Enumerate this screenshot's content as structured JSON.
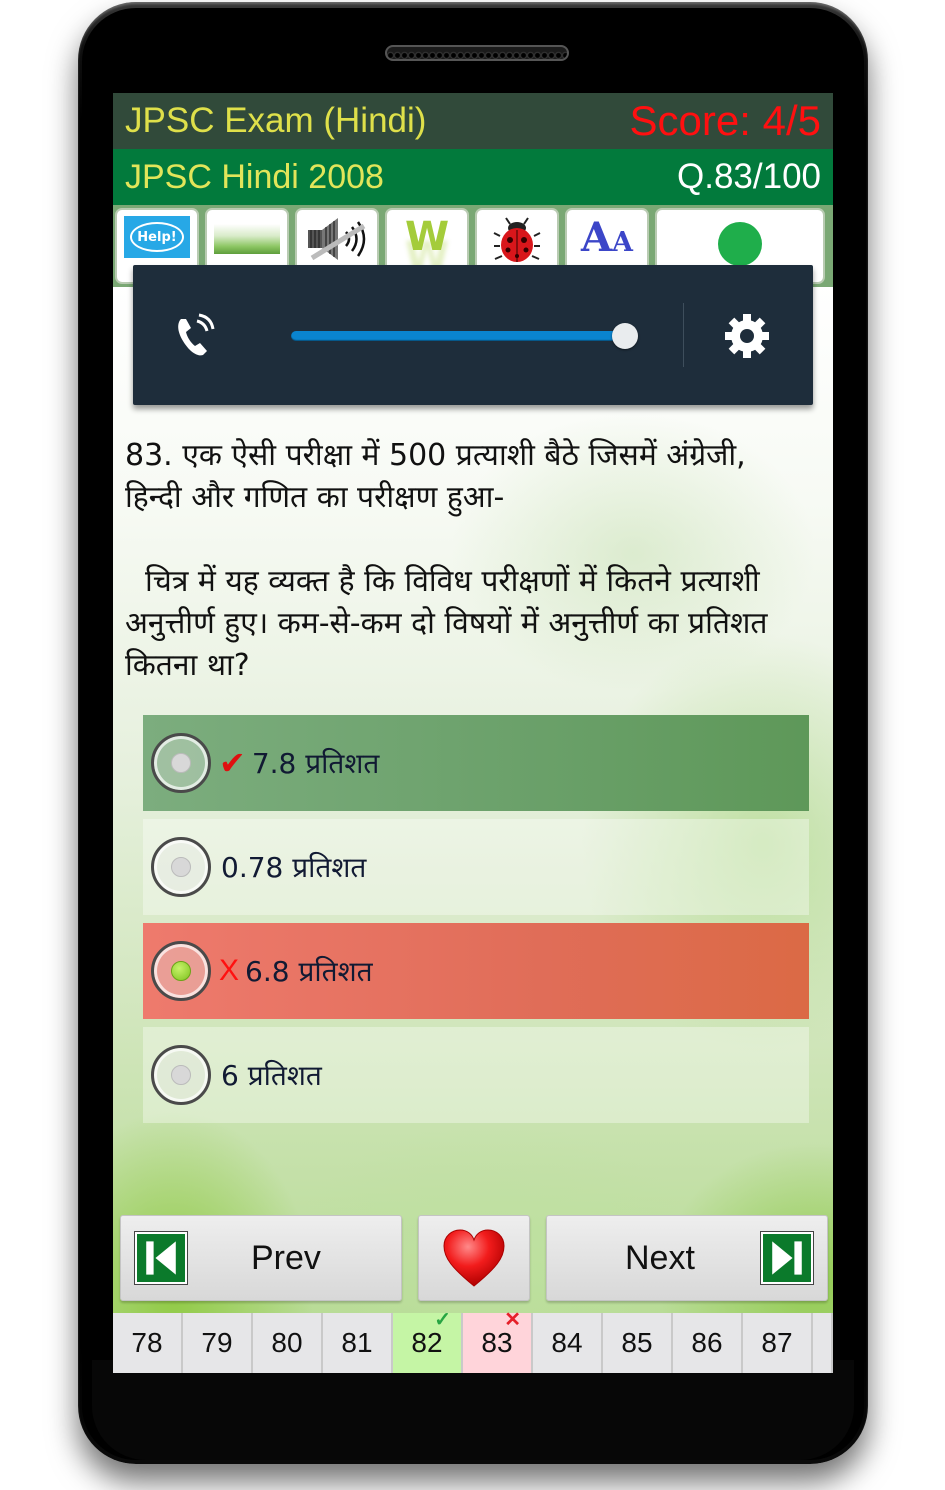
{
  "header": {
    "app_title": "JPSC Exam (Hindi)",
    "score": "Score: 4/5",
    "exam_name": "JPSC Hindi 2008",
    "question_counter": "Q.83/100"
  },
  "toolbar": {
    "items": [
      {
        "name": "help",
        "icon": "help-bubble-icon",
        "label": "Help!"
      },
      {
        "name": "theme",
        "icon": "theme-image-icon"
      },
      {
        "name": "sound",
        "icon": "sound-muted-icon"
      },
      {
        "name": "wiki",
        "icon": "w-letter-icon",
        "label": "W"
      },
      {
        "name": "report-bug",
        "icon": "ladybug-icon"
      },
      {
        "name": "font-size",
        "icon": "font-size-icon",
        "label_big": "A",
        "label_small": "A"
      },
      {
        "name": "status",
        "icon": "green-dot-icon",
        "color": "#1fae4b"
      }
    ]
  },
  "volume_panel": {
    "stream": "ringer-call",
    "level_fraction": 1.0,
    "accent_color": "#0a84cf"
  },
  "question": {
    "number": "83.",
    "text_line1": "एक ऐसी परीक्षा में 500 प्रत्याशी बैठे जिसमें अंग्रेजी, हिन्दी और गणित का परीक्षण हुआ-",
    "text_line2": "चित्र में यह व्यक्त है कि विविध परीक्षणों में कितने प्रत्याशी अनुत्तीर्ण हुए। कम-से-कम दो विषयों में अनुत्तीर्ण का प्रतिशत कितना था?"
  },
  "options": [
    {
      "text": "7.8 प्रतिशत",
      "state": "correct",
      "mark": "✔",
      "selected": false
    },
    {
      "text": "0.78 प्रतिशत",
      "state": "neutral",
      "mark": "",
      "selected": false
    },
    {
      "text": "6.8 प्रतिशत",
      "state": "wrong",
      "mark": "X",
      "selected": true
    },
    {
      "text": "6 प्रतिशत",
      "state": "neutral",
      "mark": "",
      "selected": false
    }
  ],
  "navigation": {
    "prev_label": "Prev",
    "next_label": "Next"
  },
  "question_strip": [
    {
      "n": "78",
      "status": ""
    },
    {
      "n": "79",
      "status": ""
    },
    {
      "n": "80",
      "status": ""
    },
    {
      "n": "81",
      "status": ""
    },
    {
      "n": "82",
      "status": "correct",
      "mark": "✓"
    },
    {
      "n": "83",
      "status": "wrong",
      "mark": "✕"
    },
    {
      "n": "84",
      "status": ""
    },
    {
      "n": "85",
      "status": ""
    },
    {
      "n": "86",
      "status": ""
    },
    {
      "n": "87",
      "status": ""
    }
  ]
}
